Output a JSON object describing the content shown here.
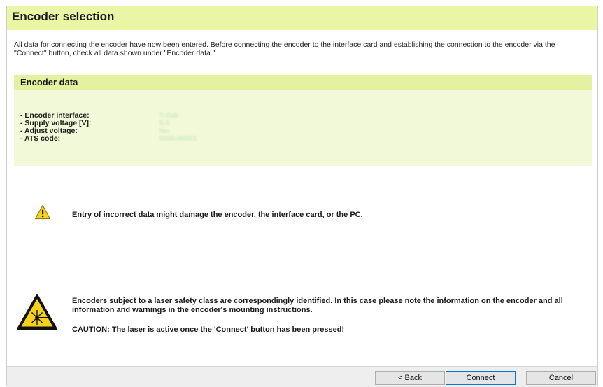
{
  "title": "Encoder selection",
  "intro": "All data for connecting the encoder have now been entered. Before connecting the encoder to the interface card and establishing the connection to the encoder via the \"Connect\" button, check all data shown under \"Encoder data.\"",
  "encoder_data": {
    "header": "Encoder data",
    "rows": [
      {
        "label": "- Encoder interface:",
        "value": "T-Sab"
      },
      {
        "label": "- Supply voltage [V]:",
        "value": "5.0"
      },
      {
        "label": "- Adjust voltage:",
        "value": "No"
      },
      {
        "label": "- ATS code:",
        "value": "0000-00001"
      }
    ]
  },
  "warning": {
    "icon": "warning-icon",
    "text": "Entry of incorrect data might damage the encoder, the interface card, or the PC."
  },
  "laser": {
    "icon": "laser-warning-icon",
    "text": "Encoders subject to a laser safety class are correspondingly identified. In this case please note the information on the encoder and all information and warnings in the encoder's mounting instructions.",
    "caution": "CAUTION: The laser is active once the 'Connect' button has been pressed!"
  },
  "buttons": {
    "back": "< Back",
    "connect": "Connect",
    "cancel": "Cancel"
  },
  "colors": {
    "title_bar": "#eaf5a6",
    "section_header": "#e4f1a0",
    "section_body": "#f2f9d9",
    "primary_border": "#0078d7"
  }
}
